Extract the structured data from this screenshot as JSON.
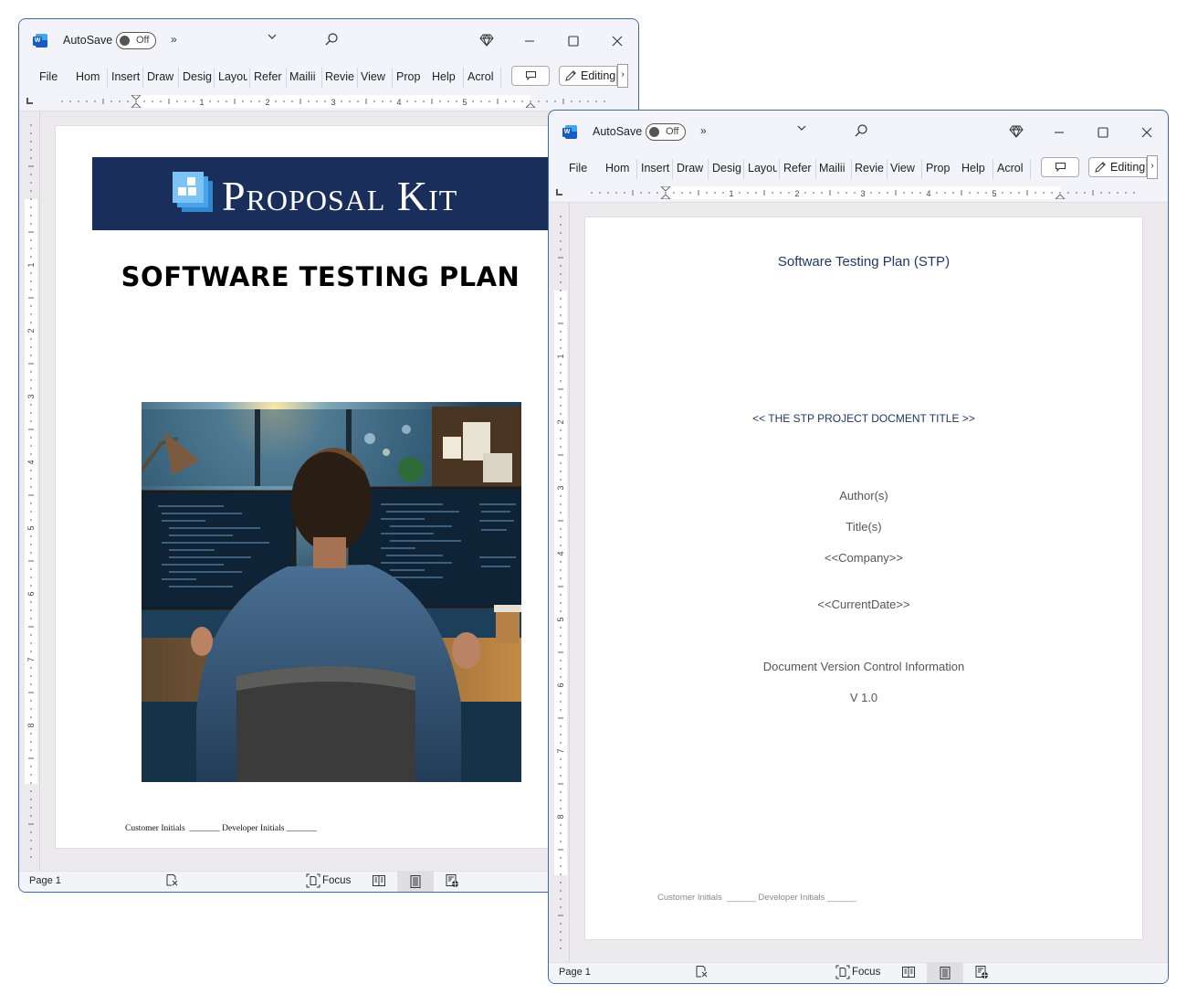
{
  "windows": {
    "left": {
      "titlebar": {
        "app_icon": "word-icon",
        "autosave_label": "AutoSave",
        "autosave_state": "Off",
        "more_icon": "double-chevron-right-icon",
        "more_glyph": "»",
        "dropdown_icon": "chevron-down-icon",
        "search_icon": "search-icon",
        "premium_icon": "diamond-icon",
        "controls": [
          "minimize-icon",
          "maximize-icon",
          "close-icon"
        ]
      },
      "ribbon": {
        "tabs": [
          "File",
          "Home",
          "Insert",
          "Draw",
          "Design",
          "Layout",
          "References",
          "Mailings",
          "Review",
          "View",
          "Properties",
          "Help",
          "Acrobat"
        ],
        "tabs_visible": [
          "File",
          "Hom",
          "Insert",
          "Draw",
          "Desig",
          "Layou",
          "Refer",
          "Mailii",
          "Revie",
          "View",
          "Prop",
          "Help",
          "Acrol"
        ],
        "comment_icon": "comment-icon",
        "editing_label": "Editing",
        "editing_more_glyph": "›"
      },
      "ruler": {
        "h_numbers": [
          "1",
          "2",
          "3",
          "4",
          "5"
        ],
        "v_numbers": [
          "1",
          "2",
          "3",
          "4",
          "5",
          "6",
          "7",
          "8"
        ]
      },
      "page": {
        "brand": "Proposal Kit",
        "title": "SOFTWARE TESTING PLAN",
        "image_alt": "Developer at desk with dual monitors showing code",
        "initials_line": "Customer Initials  _______ Developer Initials _______"
      },
      "statusbar": {
        "page_label": "Page 1",
        "focus_label": "Focus",
        "active_view": "print-layout"
      }
    },
    "right": {
      "titlebar": {
        "app_icon": "word-icon",
        "autosave_label": "AutoSave",
        "autosave_state": "Off",
        "more_glyph": "»"
      },
      "ribbon": {
        "tabs_visible": [
          "File",
          "Hom",
          "Insert",
          "Draw",
          "Desig",
          "Layou",
          "Refer",
          "Mailii",
          "Revie",
          "View",
          "Prop",
          "Help",
          "Acrol"
        ],
        "editing_label": "Editing",
        "editing_more_glyph": "›"
      },
      "ruler": {
        "h_numbers": [
          "1",
          "2",
          "3",
          "4",
          "5"
        ],
        "v_numbers": [
          "1",
          "2",
          "3",
          "4",
          "5",
          "6",
          "7",
          "8"
        ]
      },
      "page": {
        "title": "Software Testing Plan (STP)",
        "project_title": "<< THE STP PROJECT DOCMENT TITLE >>",
        "authors": "Author(s)",
        "titles": "Title(s)",
        "company": "<<Company>>",
        "current_date": "<<CurrentDate>>",
        "version_heading": "Document Version Control Information",
        "version": "V 1.0",
        "initials_line": "Customer Initials  ______ Developer Initials ______"
      },
      "statusbar": {
        "page_label": "Page 1",
        "focus_label": "Focus",
        "active_view": "print-layout"
      }
    }
  },
  "colors": {
    "window_border": "#3c6aa8",
    "banner_navy": "#1a2e5c",
    "heading_navy": "#1f3864",
    "word_blue": "#185abd"
  }
}
